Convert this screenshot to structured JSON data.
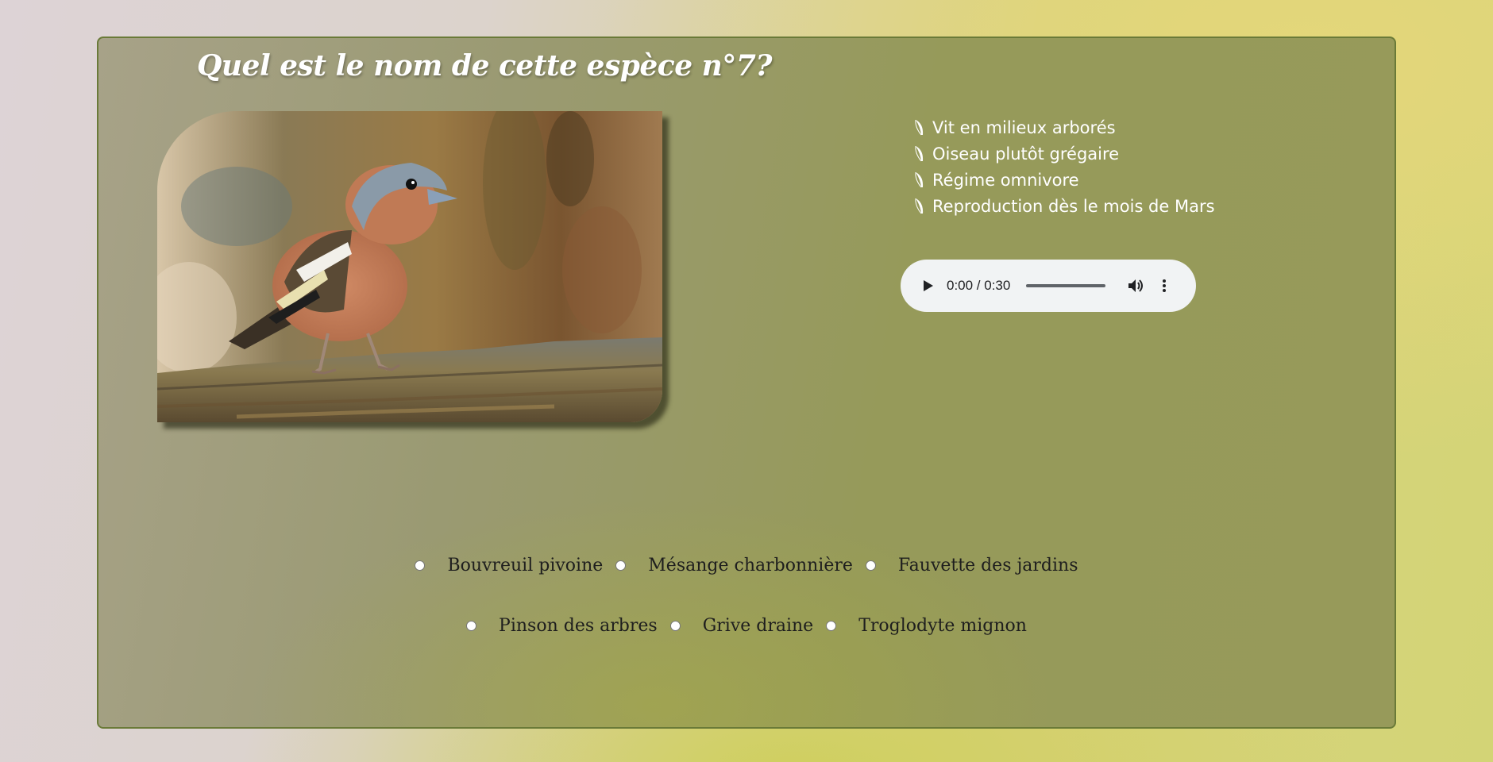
{
  "quiz": {
    "title": "Quel est le nom de cette espèce n°7?"
  },
  "photo": {
    "subject": "bird-photo",
    "colors": {
      "breast": "#c07a55",
      "head": "#8a9aa8",
      "background": "#8a7040"
    }
  },
  "hints": [
    {
      "icon": "feather-icon",
      "text": "Vit en milieux arborés"
    },
    {
      "icon": "feather-icon",
      "text": "Oiseau plutôt grégaire"
    },
    {
      "icon": "feather-icon",
      "text": "Régime omnivore"
    },
    {
      "icon": "feather-icon",
      "text": "Reproduction dès le mois de Mars"
    }
  ],
  "audio": {
    "time": "0:00 / 0:30",
    "progress": 0,
    "icons": {
      "play": "play-icon",
      "volume": "volume-icon",
      "more": "more-vertical-icon"
    }
  },
  "choices": {
    "row1": [
      {
        "label": "Bouvreuil pivoine",
        "selected": false
      },
      {
        "label": "Mésange charbonnière",
        "selected": false
      },
      {
        "label": "Fauvette des jardins",
        "selected": false
      }
    ],
    "row2": [
      {
        "label": "Pinson des arbres",
        "selected": false
      },
      {
        "label": "Grive draine",
        "selected": false
      },
      {
        "label": "Troglodyte mignon",
        "selected": false
      }
    ]
  },
  "colors": {
    "panel_border": "#6a7a38",
    "text_light": "#ffffff",
    "text_dark": "#1e1e1e",
    "player_bg": "#f1f3f4"
  }
}
